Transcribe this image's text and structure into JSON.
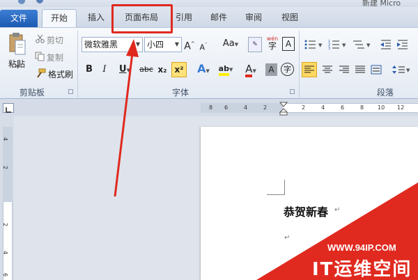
{
  "window": {
    "title_fragment": "新建 Micro"
  },
  "tabs": [
    {
      "label": "文件"
    },
    {
      "label": "开始"
    },
    {
      "label": "插入"
    },
    {
      "label": "页面布局"
    },
    {
      "label": "引用"
    },
    {
      "label": "邮件"
    },
    {
      "label": "审阅"
    },
    {
      "label": "视图"
    }
  ],
  "clipboard": {
    "paste_label": "粘贴",
    "cut_label": "剪切",
    "copy_label": "复制",
    "format_painter_label": "格式刷",
    "group_label": "剪贴板"
  },
  "font": {
    "font_name": "微软雅黑",
    "font_size": "小四",
    "grow_label": "A",
    "shrink_label": "A",
    "case_label": "Aa",
    "bold_label": "B",
    "italic_label": "I",
    "underline_label": "U",
    "strike_label": "abc",
    "subscript_label": "x₂",
    "superscript_label": "x²",
    "effects_label": "A",
    "highlight_label": "ab",
    "fontcolor_label": "A",
    "shading_label": "A",
    "enclose_label": "字",
    "phonetic_label": "wén",
    "border_label": "A",
    "group_label": "字体"
  },
  "paragraph": {
    "group_label": "段落"
  },
  "ruler": {
    "h_ticks": [
      "8",
      "6",
      "4",
      "2",
      "2",
      "4",
      "6",
      "8",
      "10",
      "12"
    ],
    "v_ticks": [
      "4",
      "2",
      "2",
      "4",
      "6"
    ]
  },
  "document": {
    "title_text": "恭贺新春",
    "paragraph_mark": "↵"
  },
  "watermark": {
    "url": "WWW.94IP.COM",
    "brand": "IT运维空间"
  },
  "colors": {
    "file_tab": "#1d5bb2",
    "highlight_box": "#e0291e",
    "arrow": "#e0291e",
    "watermark_band": "#e02a1f"
  }
}
